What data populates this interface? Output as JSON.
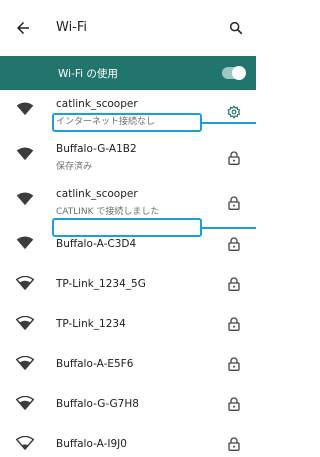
{
  "header": {
    "title": "Wi-Fi",
    "back_icon": "arrow-left-icon",
    "search_icon": "search-icon"
  },
  "wifi_toggle": {
    "label": "Wi-Fi の使用",
    "state": "on",
    "accent_color": "#21756d"
  },
  "networks": [
    {
      "name": "catlink_scooper",
      "status": "インターネット接続なし",
      "signal": "full",
      "trailing_icon": "gear-icon"
    },
    {
      "name": "Buffalo-G-A1B2",
      "status": "保存済み",
      "signal": "full",
      "trailing_icon": "lock-icon"
    },
    {
      "name": "catlink_scooper",
      "status": "CATLINK で接続しました",
      "signal": "full",
      "trailing_icon": "lock-icon"
    },
    {
      "name": "Buffalo-A-C3D4",
      "status": "",
      "signal": "full",
      "trailing_icon": "lock-icon"
    },
    {
      "name": "TP-Link_1234_5G",
      "status": "",
      "signal": "good",
      "trailing_icon": "lock-icon"
    },
    {
      "name": "TP-Link_1234",
      "status": "",
      "signal": "good",
      "trailing_icon": "lock-icon"
    },
    {
      "name": "Buffalo-A-E5F6",
      "status": "",
      "signal": "good",
      "trailing_icon": "lock-icon"
    },
    {
      "name": "Buffalo-G-G7H8",
      "status": "",
      "signal": "good",
      "trailing_icon": "lock-icon"
    },
    {
      "name": "Buffalo-A-I9J0",
      "status": "",
      "signal": "weak",
      "trailing_icon": "lock-icon"
    }
  ],
  "annotation_color": "#1a9fd9"
}
